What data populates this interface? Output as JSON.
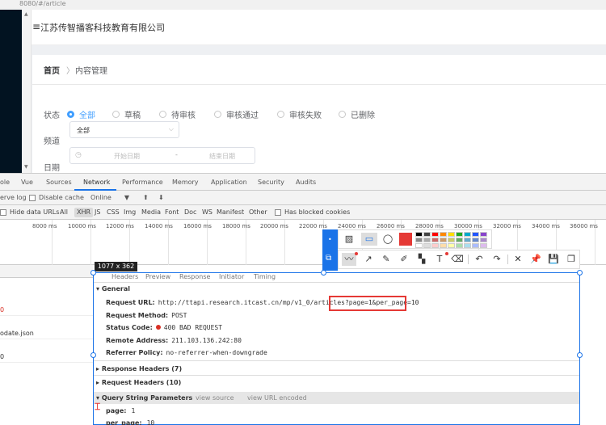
{
  "browser": {
    "address_fragment": "8080/#/article"
  },
  "app": {
    "title": "江苏传智播客科技教育有限公司",
    "breadcrumb": {
      "home": "首页",
      "separator": "〉",
      "current": "内容管理"
    },
    "filters": {
      "status_label": "状态",
      "status_options": [
        "全部",
        "草稿",
        "待审核",
        "审核通过",
        "审核失败",
        "已删除"
      ],
      "status_selected": "全部",
      "channel_label": "频道",
      "channel_value": "全部",
      "date_label": "日期",
      "date_start_placeholder": "开始日期",
      "date_separator": "-",
      "date_end_placeholder": "结束日期"
    }
  },
  "devtools": {
    "tabs": [
      "ole",
      "Vue",
      "Sources",
      "Network",
      "Performance",
      "Memory",
      "Application",
      "Security",
      "Audits"
    ],
    "active_tab": "Network",
    "toolbar": {
      "preserve_log": "erve log",
      "disable_cache": "Disable cache",
      "throttle": "Online",
      "throttle_arrow": "▼",
      "upload_icon": "⬆",
      "download_icon": "⬇"
    },
    "filter_bar": {
      "hide_data_urls": "Hide data URLs",
      "types": [
        "All",
        "XHR",
        "JS",
        "CSS",
        "Img",
        "Media",
        "Font",
        "Doc",
        "WS",
        "Manifest",
        "Other"
      ],
      "active_type": "XHR",
      "has_blocked": "Has blocked cookies"
    },
    "timeline_ticks": [
      "8000 ms",
      "10000 ms",
      "12000 ms",
      "14000 ms",
      "16000 ms",
      "18000 ms",
      "20000 ms",
      "22000 ms",
      "24000 ms",
      "26000 ms",
      "28000 ms",
      "30000 ms",
      "32000 ms",
      "34000 ms",
      "36000 ms"
    ],
    "request_list": [
      {
        "text": "0",
        "error": true
      },
      {
        "text": "odate.json",
        "error": false
      },
      {
        "text": "0",
        "error": false
      }
    ],
    "detail": {
      "tabs": [
        "Headers",
        "Preview",
        "Response",
        "Initiator",
        "Timing"
      ],
      "general": {
        "title": "General",
        "request_url_label": "Request URL:",
        "request_url": "http://ttapi.research.itcast.cn/mp/v1_0/articles?page=1&per_page=10",
        "method_label": "Request Method:",
        "method": "POST",
        "status_label": "Status Code:",
        "status": "400 BAD REQUEST",
        "remote_label": "Remote Address:",
        "remote": "211.103.136.242:80",
        "referrer_label": "Referrer Policy:",
        "referrer": "no-referrer-when-downgrade"
      },
      "response_headers": "Response Headers (7)",
      "request_headers": "Request Headers (10)",
      "query_string": {
        "title": "Query String Parameters",
        "view_source": "view source",
        "view_url": "view URL encoded",
        "params": [
          {
            "key": "page:",
            "value": "1"
          },
          {
            "key": "per_page:",
            "value": "10"
          }
        ]
      }
    }
  },
  "snip": {
    "size_label": "1077 x 362",
    "colors": {
      "current": "#e53935",
      "palette": [
        "#000000",
        "#444444",
        "#ff0000",
        "#ff8800",
        "#ffdd00",
        "#22aa22",
        "#00aacc",
        "#2255ff",
        "#8844cc",
        "#888888",
        "#aaaaaa",
        "#cc6666",
        "#cc9966",
        "#cccc66",
        "#66aa66",
        "#66aacc",
        "#6688cc",
        "#aa88cc",
        "#ffffff",
        "#dddddd",
        "#ffcccc",
        "#ffddaa",
        "#ffffaa",
        "#aaddaa",
        "#aaddee",
        "#aabbff",
        "#ddbbee"
      ]
    }
  }
}
